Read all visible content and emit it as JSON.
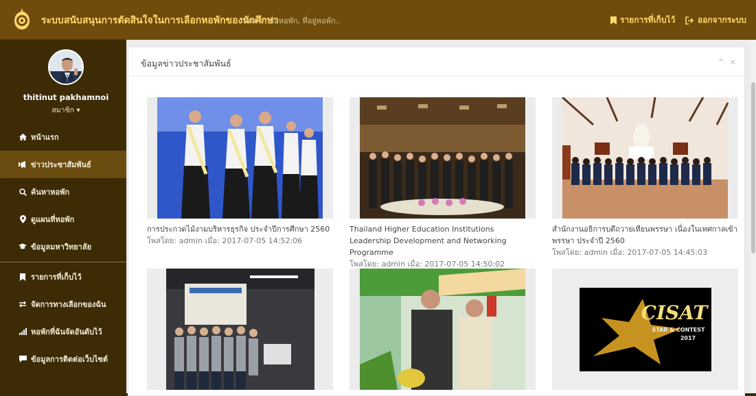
{
  "header": {
    "title": "ระบบสนับสนุนการตัดสินใจในการเลือกหอพักของนักศึกษา",
    "search_placeholder": "ค้นจาก ชื่อหอพัก, ที่อยู่หอพัก..",
    "saved_label": "รายการที่เก็บไว้",
    "logout_label": "ออกจากระบบ",
    "accent": "#ffd86a"
  },
  "user": {
    "name": "thitinut  pakhamnoi",
    "role": "สมาชิก ▾"
  },
  "sidebar": {
    "items": [
      {
        "label": "หน้าแรก",
        "icon": "home-icon"
      },
      {
        "label": "ข่าวประชาสัมพันธ์",
        "icon": "megaphone-icon"
      },
      {
        "label": "ค้นหาหอพัก",
        "icon": "search-icon"
      },
      {
        "label": "ดูแผนที่หอพัก",
        "icon": "map-marker-icon"
      },
      {
        "label": "ข้อมูลมหาวิทยาลัย",
        "icon": "graduation-cap-icon"
      },
      {
        "label": "รายการที่เก็บไว้",
        "icon": "bookmark-icon"
      },
      {
        "label": "จัดการทางเลือกของฉัน",
        "icon": "exchange-icon"
      },
      {
        "label": "หอพักที่ฉันจัดอันดับไว้",
        "icon": "bar-chart-icon"
      },
      {
        "label": "ข้อมูลการติดต่อเว็บไซต์",
        "icon": "comment-icon"
      }
    ]
  },
  "panel": {
    "title": "ข้อมูลข่าวประชาสัมพันธ์",
    "collapse": "^",
    "close": "×"
  },
  "news": [
    {
      "title": "การประกวดไม้งามบริหารธุรกิจ ประจำปีการศึกษา 2560",
      "meta": "โพสโดย: admin เมื่อ: 2017-07-05 14:52:06"
    },
    {
      "title": "Thailand Higher Education Institutions Leadership Development and Networking Programme",
      "meta": "โพสโดย: admin เมื่อ: 2017-07-05 14:50:02"
    },
    {
      "title": "สำนักงานอธิการบดีถวายเทียนพรรษา เนื่องในเทศกาลเข้าพรรษา ประจำปี 2560",
      "meta": "โพสโดย: admin เมื่อ: 2017-07-05 14:45:03"
    },
    {
      "title": "",
      "meta": ""
    },
    {
      "title": "",
      "meta": ""
    },
    {
      "title": "",
      "meta": ""
    }
  ],
  "cisat_logo": {
    "word": "CISAT",
    "sub": "STAR & CONTEST",
    "year": "2017"
  }
}
